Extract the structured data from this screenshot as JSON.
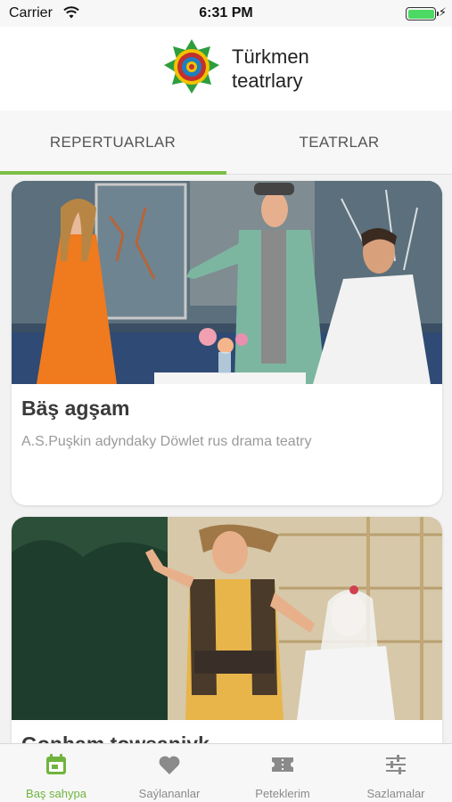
{
  "status_bar": {
    "carrier": "Carrier",
    "time": "6:31 PM"
  },
  "header": {
    "title_line1": "Türkmen",
    "title_line2": "teatrlary"
  },
  "tabs": [
    {
      "label": "REPERTUARLAR",
      "selected": true
    },
    {
      "label": "TEATRLAR",
      "selected": false
    }
  ],
  "cards": [
    {
      "title": "Bäş agşam",
      "subtitle": "A.S.Puşkin adyndaky Döwlet rus drama teatry",
      "image": "theatre-scene-photo"
    },
    {
      "title": "Gonham towşanjyk",
      "subtitle": "",
      "image": "theatre-scene-photo"
    }
  ],
  "bottom_nav": [
    {
      "label": "Baş sahypa",
      "icon": "calendar-icon",
      "active": true
    },
    {
      "label": "Saýlananlar",
      "icon": "heart-icon",
      "active": false
    },
    {
      "label": "Peteklerim",
      "icon": "ticket-icon",
      "active": false
    },
    {
      "label": "Sazlamalar",
      "icon": "sliders-icon",
      "active": false
    }
  ],
  "colors": {
    "accent": "#7bbf46",
    "active_tab_label": "#6fb43f",
    "card_title": "#3a3a3a"
  }
}
